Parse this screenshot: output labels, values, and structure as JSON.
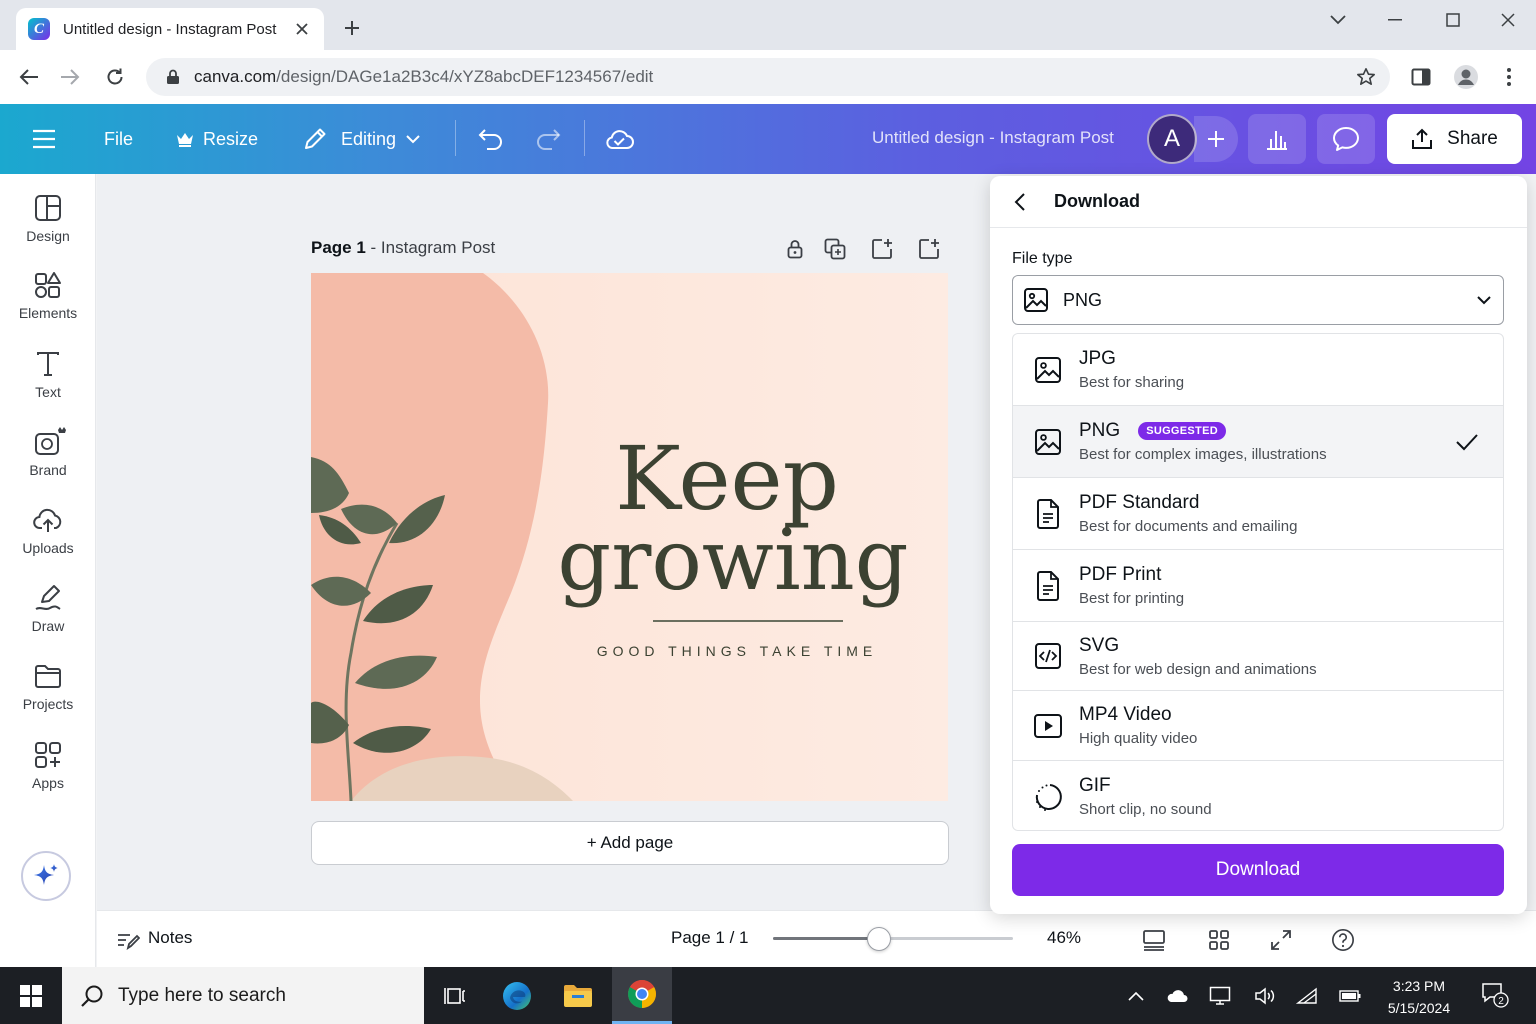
{
  "browser": {
    "tab_title": "Untitled design - Instagram Post",
    "favicon_letter": "C",
    "url_host": "canva.com",
    "url_path": "/design/DAGe1a2B3c4/xYZ8abcDEF1234567/edit"
  },
  "header": {
    "file_label": "File",
    "resize_label": "Resize",
    "editing_label": "Editing",
    "doc_title": "Untitled design - Instagram Post",
    "avatar_initial": "A",
    "share_label": "Share",
    "gradient_start": "#1ba8cf",
    "gradient_end": "#7344e4"
  },
  "sidebar": {
    "items": [
      {
        "label": "Design",
        "icon": "layout-icon"
      },
      {
        "label": "Elements",
        "icon": "shapes-icon"
      },
      {
        "label": "Text",
        "icon": "text-icon"
      },
      {
        "label": "Brand",
        "icon": "brand-icon"
      },
      {
        "label": "Uploads",
        "icon": "cloud-upload-icon"
      },
      {
        "label": "Draw",
        "icon": "pen-icon"
      },
      {
        "label": "Projects",
        "icon": "folder-icon"
      },
      {
        "label": "Apps",
        "icon": "apps-icon"
      }
    ]
  },
  "canvas": {
    "page_label_bold": "Page 1",
    "page_label_rest": " - Instagram Post",
    "design_title_line1": "Keep",
    "design_title_line2": "growing",
    "design_subtitle": "GOOD THINGS TAKE TIME",
    "add_page_label": "+ Add page",
    "design_bg": "#fde9df",
    "blob_color": "#f4bba8",
    "leaf_color": "#5e6a55"
  },
  "bottombar": {
    "notes_label": "Notes",
    "page_indicator": "Page 1 / 1",
    "zoom": "46%",
    "zoom_slider_fraction": 0.44
  },
  "download_panel": {
    "title": "Download",
    "file_type_label": "File type",
    "selected_type": "PNG",
    "options": [
      {
        "name": "JPG",
        "desc": "Best for sharing",
        "icon": "image-icon"
      },
      {
        "name": "PNG",
        "desc": "Best for complex images, illustrations",
        "icon": "image-icon",
        "badge": "SUGGESTED",
        "selected": true
      },
      {
        "name": "PDF Standard",
        "desc": "Best for documents and emailing",
        "icon": "document-icon"
      },
      {
        "name": "PDF Print",
        "desc": "Best for printing",
        "icon": "document-icon"
      },
      {
        "name": "SVG",
        "desc": "Best for web design and animations",
        "icon": "code-icon"
      },
      {
        "name": "MP4 Video",
        "desc": "High quality video",
        "icon": "video-icon"
      },
      {
        "name": "GIF",
        "desc": "Short clip, no sound",
        "icon": "gif-icon"
      }
    ],
    "download_button": "Download",
    "accent": "#7d2ae8"
  },
  "taskbar": {
    "search_placeholder": "Type here to search",
    "time": "3:23 PM",
    "date": "5/15/2024",
    "notification_count": "2"
  }
}
